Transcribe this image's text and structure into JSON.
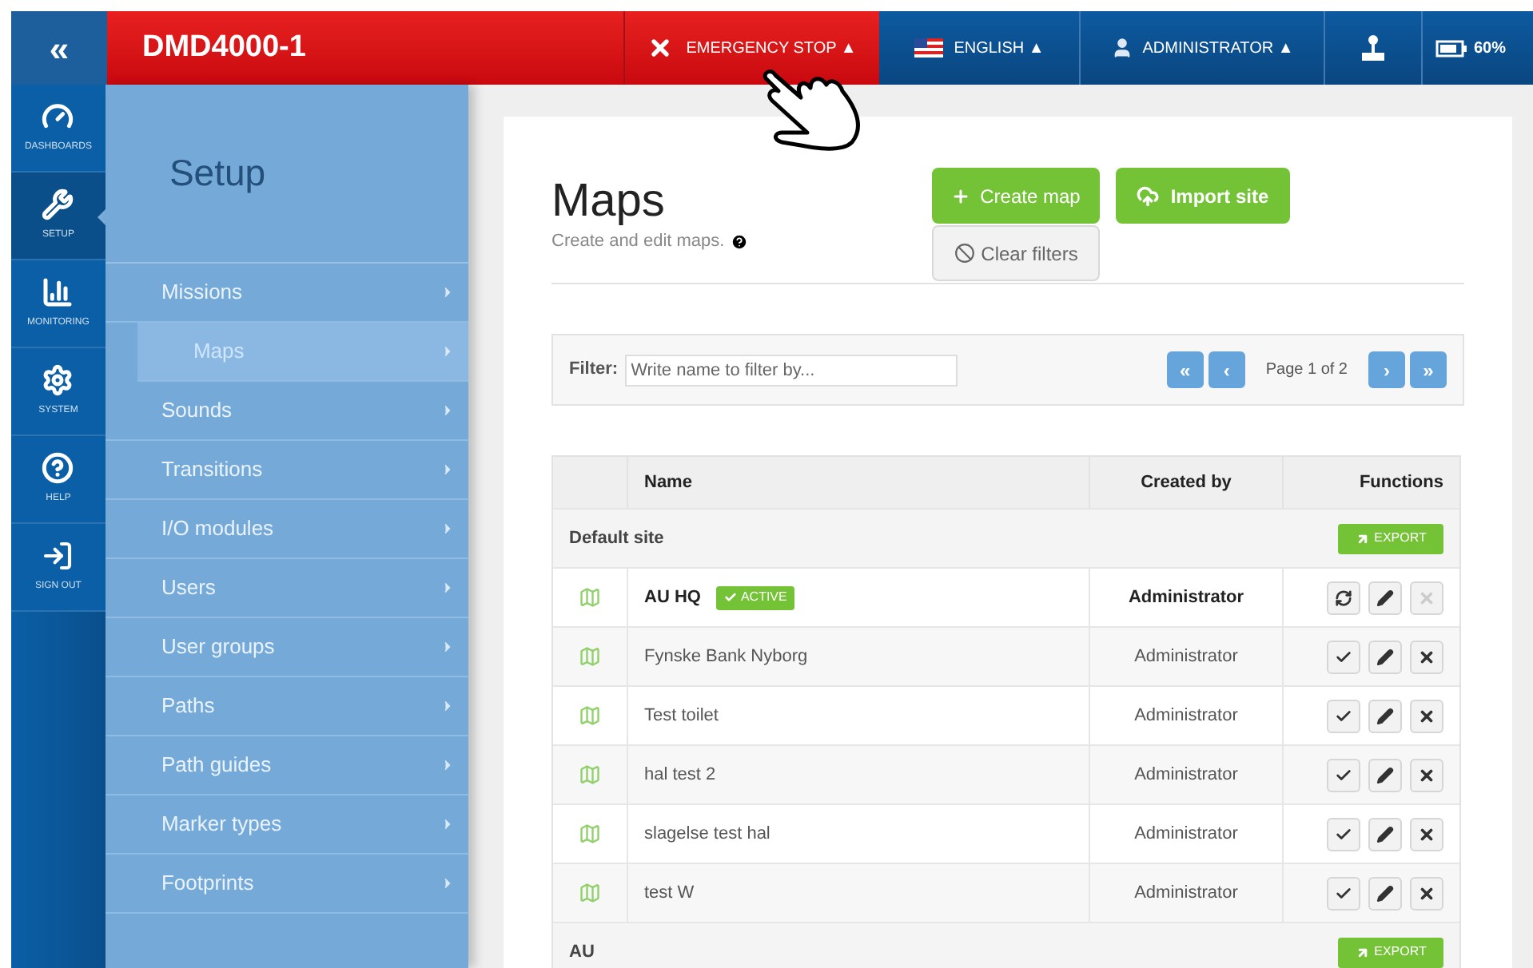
{
  "header": {
    "collapse": "«",
    "robot_name": "DMD4000-1",
    "emergency_stop": "EMERGENCY STOP ▲",
    "language": "ENGLISH ▲",
    "user": "ADMINISTRATOR ▲",
    "battery": "60%"
  },
  "nav": [
    {
      "label": "DASHBOARDS",
      "selected": false
    },
    {
      "label": "SETUP",
      "selected": true
    },
    {
      "label": "MONITORING",
      "selected": false
    },
    {
      "label": "SYSTEM",
      "selected": false
    },
    {
      "label": "HELP",
      "selected": false
    },
    {
      "label": "SIGN OUT",
      "selected": false
    }
  ],
  "setup_menu": {
    "title": "Setup",
    "items": [
      {
        "label": "Missions",
        "selected": false
      },
      {
        "label": "Maps",
        "selected": true
      },
      {
        "label": "Sounds",
        "selected": false
      },
      {
        "label": "Transitions",
        "selected": false
      },
      {
        "label": "I/O modules",
        "selected": false
      },
      {
        "label": "Users",
        "selected": false
      },
      {
        "label": "User groups",
        "selected": false
      },
      {
        "label": "Paths",
        "selected": false
      },
      {
        "label": "Path guides",
        "selected": false
      },
      {
        "label": "Marker types",
        "selected": false
      },
      {
        "label": "Footprints",
        "selected": false
      }
    ]
  },
  "page": {
    "title": "Maps",
    "subtitle": "Create and edit maps.",
    "create_button": "Create map",
    "import_button": "Import site",
    "clear_button": "Clear filters"
  },
  "filter": {
    "label": "Filter:",
    "placeholder": "Write name to filter by...",
    "first": "«",
    "prev": "‹",
    "page": "Page 1 of 2",
    "next": "›",
    "last": "»"
  },
  "table": {
    "columns": [
      "Name",
      "Created by",
      "Functions"
    ],
    "groups": [
      {
        "name": "Default site",
        "export": "EXPORT",
        "rows": [
          {
            "name": "AU HQ",
            "active": true,
            "badge": "ACTIVE",
            "created_by": "Administrator"
          },
          {
            "name": "Fynske Bank Nyborg",
            "active": false,
            "created_by": "Administrator"
          },
          {
            "name": "Test toilet",
            "active": false,
            "created_by": "Administrator"
          },
          {
            "name": "hal test 2",
            "active": false,
            "created_by": "Administrator"
          },
          {
            "name": "slagelse test hal",
            "active": false,
            "created_by": "Administrator"
          },
          {
            "name": "test W",
            "active": false,
            "created_by": "Administrator"
          }
        ]
      },
      {
        "name": "AU",
        "export": "EXPORT"
      }
    ]
  }
}
